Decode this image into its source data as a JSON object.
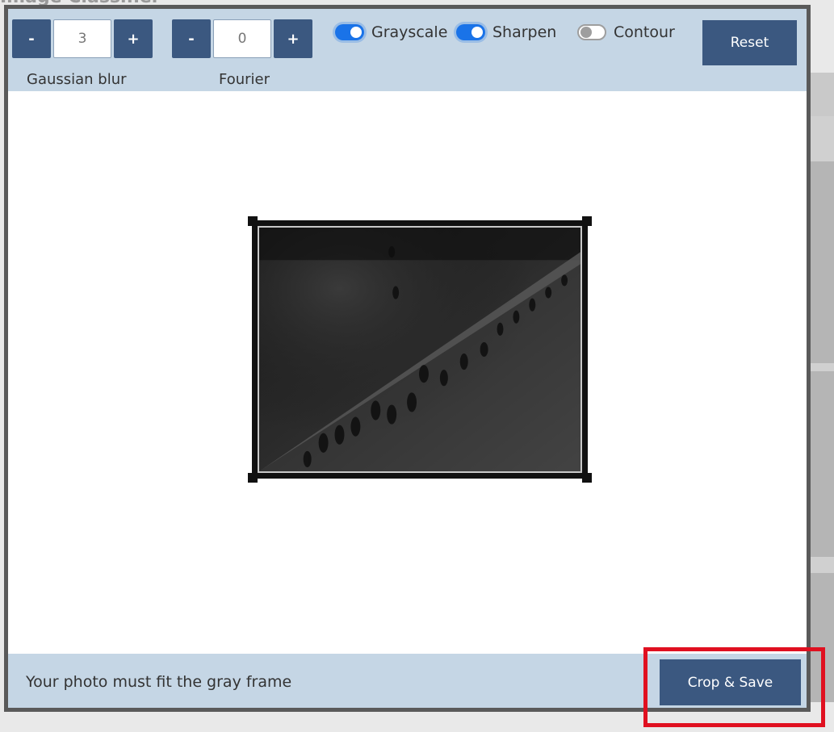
{
  "background": {
    "title": "Image Classifier"
  },
  "toolbar": {
    "blur": {
      "label": "Gaussian blur",
      "value": "3",
      "minus": "-",
      "plus": "+"
    },
    "fourier": {
      "label": "Fourier",
      "value": "0",
      "minus": "-",
      "plus": "+"
    },
    "toggles": [
      {
        "label": "Grayscale",
        "checked": true
      },
      {
        "label": "Sharpen",
        "checked": true
      },
      {
        "label": "Contour",
        "checked": false
      }
    ],
    "reset_label": "Reset"
  },
  "footer": {
    "message": "Your photo must fit the gray frame",
    "save_label": "Crop & Save"
  },
  "colors": {
    "accent": "#3b5880",
    "panel": "#c5d6e5",
    "toggle_on": "#1a73e8",
    "highlight": "#e01020"
  },
  "icons": {
    "photo": "grayscale-metal-plate-photo"
  }
}
